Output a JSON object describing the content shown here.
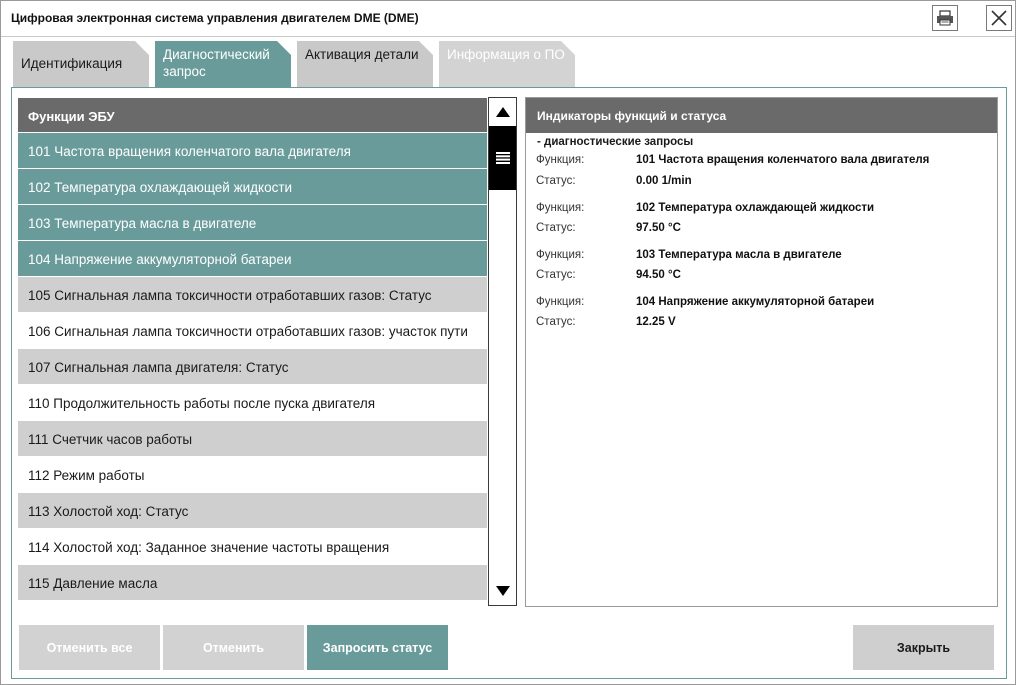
{
  "window": {
    "title": "Цифровая электронная система управления двигателем DME (DME)",
    "icons": {
      "print": "print-icon",
      "close": "close-icon"
    }
  },
  "tabs": [
    {
      "label": "Идентификация",
      "state": "normal"
    },
    {
      "label": "Диагностический запрос",
      "state": "active"
    },
    {
      "label": "Активация детали",
      "state": "normal"
    },
    {
      "label": "Информация о ПО",
      "state": "disabled"
    }
  ],
  "list": {
    "header": "Функции ЭБУ",
    "items": [
      {
        "label": "101 Частота вращения коленчатого вала двигателя",
        "state": "selected"
      },
      {
        "label": "102 Температура охлаждающей жидкости",
        "state": "selected"
      },
      {
        "label": "103 Температура масла в двигателе",
        "state": "selected"
      },
      {
        "label": "104 Напряжение аккумуляторной батареи",
        "state": "selected"
      },
      {
        "label": "105 Сигнальная лампа токсичности отработавших газов: Статус",
        "state": "gray"
      },
      {
        "label": "106 Сигнальная лампа токсичности отработавших газов: участок пути",
        "state": "white"
      },
      {
        "label": "107 Сигнальная лампа двигателя: Статус",
        "state": "gray"
      },
      {
        "label": "110 Продолжительность работы после пуска двигателя",
        "state": "white"
      },
      {
        "label": "111 Счетчик часов работы",
        "state": "gray"
      },
      {
        "label": "112 Режим работы",
        "state": "white"
      },
      {
        "label": "113 Холостой ход: Статус",
        "state": "gray"
      },
      {
        "label": "114 Холостой ход: Заданное значение частоты вращения",
        "state": "white"
      },
      {
        "label": "115 Давление масла",
        "state": "gray"
      }
    ]
  },
  "panel": {
    "header": "Индикаторы функций и статуса",
    "subheader": "- диагностические запросы",
    "function_label": "Функция:",
    "status_label": "Статус:",
    "entries": [
      {
        "function": "101 Частота вращения коленчатого вала двигателя",
        "status": "0.00  1/min"
      },
      {
        "function": "102 Температура охлаждающей жидкости",
        "status": "97.50  °C"
      },
      {
        "function": "103 Температура масла в двигателе",
        "status": "94.50  °C"
      },
      {
        "function": "104 Напряжение аккумуляторной батареи",
        "status": "12.25  V"
      }
    ]
  },
  "buttons": {
    "cancel_all": "Отменить все",
    "cancel": "Отменить",
    "request_status": "Запросить статус",
    "close": "Закрыть"
  },
  "colors": {
    "accent": "#6a9b9b",
    "header_gray": "#6a6a6a",
    "row_gray": "#cfcfcf",
    "disabled": "#d2d2d2"
  }
}
